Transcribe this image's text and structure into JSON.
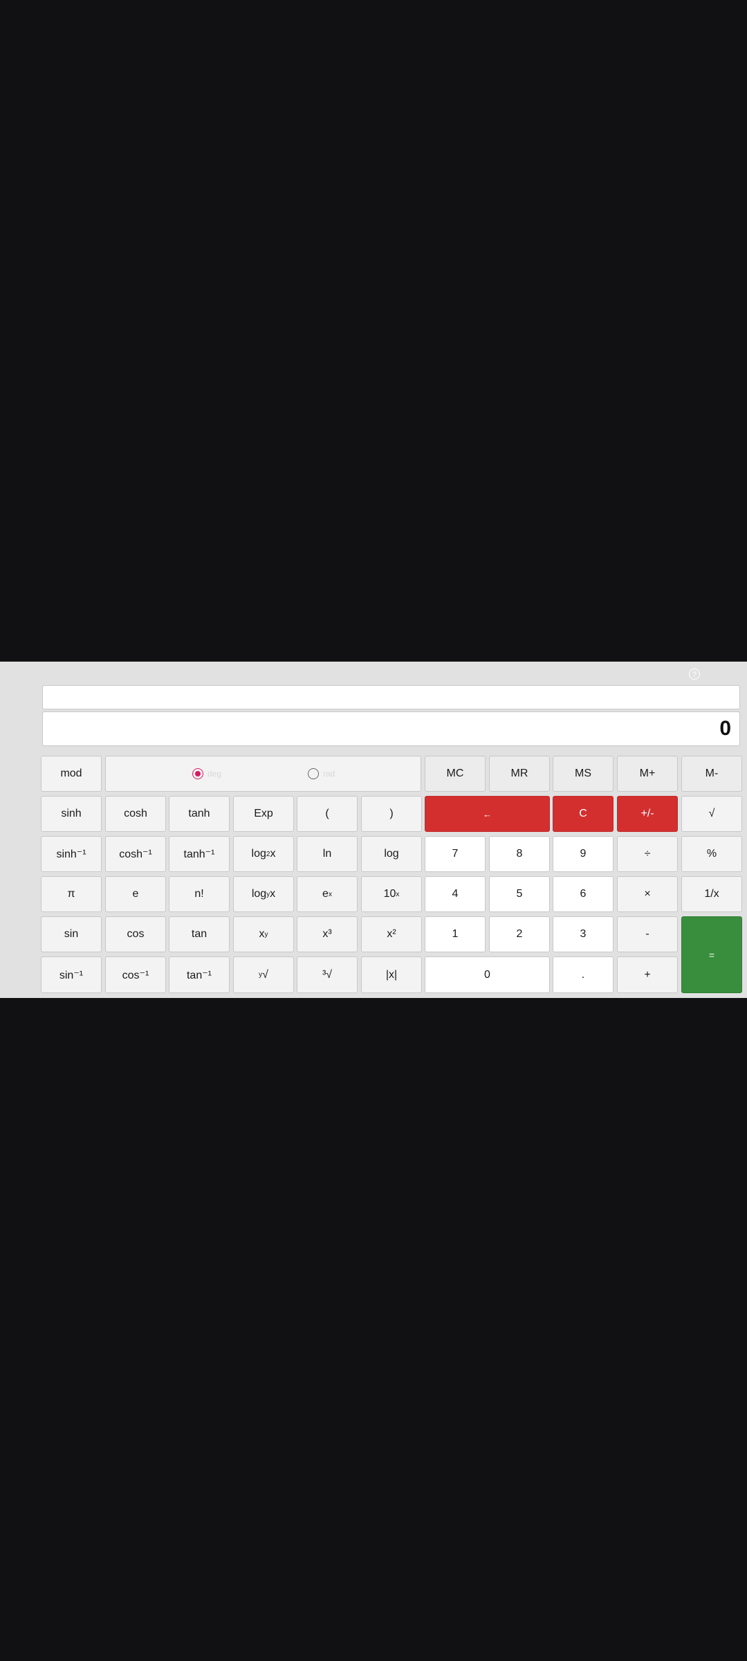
{
  "display": {
    "expression": "",
    "result": "0"
  },
  "angle_mode": {
    "options": [
      {
        "label": "deg",
        "selected": true
      },
      {
        "label": "rad",
        "selected": false
      }
    ]
  },
  "memory": {
    "mc": "MC",
    "mr": "MR",
    "ms": "MS",
    "mplus": "M+",
    "mminus": "M-"
  },
  "keys": {
    "mod": "mod",
    "sinh": "sinh",
    "cosh": "cosh",
    "tanh": "tanh",
    "exp": "Exp",
    "lparen": "(",
    "rparen": ")",
    "backspace": "←",
    "clear": "C",
    "negate": "+/-",
    "sqrt": "√",
    "asinh": "sinh⁻¹",
    "acosh": "cosh⁻¹",
    "atanh": "tanh⁻¹",
    "log2_base": "log",
    "log2_sub": "2",
    "log2_x": "x",
    "ln": "ln",
    "log": "log",
    "seven": "7",
    "eight": "8",
    "nine": "9",
    "divide": "÷",
    "percent": "%",
    "pi": "π",
    "e": "e",
    "factorial": "n!",
    "logy_base": "log",
    "logy_sub": "y",
    "logy_x": "x",
    "exp_base": "e",
    "exp_sup": "x",
    "ten_pow_base": "10",
    "ten_pow_sup": "x",
    "four": "4",
    "five": "5",
    "six": "6",
    "multiply": "×",
    "reciprocal": "1/x",
    "sin": "sin",
    "cos": "cos",
    "tan": "tan",
    "pow_base": "x",
    "pow_sup": "y",
    "cube": "x³",
    "square": "x²",
    "one": "1",
    "two": "2",
    "three": "3",
    "minus": "-",
    "equals": "=",
    "asin": "sin⁻¹",
    "acos": "cos⁻¹",
    "atan": "tan⁻¹",
    "yroot_sup": "y",
    "yroot_sym": "√",
    "cbrt": "³√",
    "abs": "|x|",
    "zero": "0",
    "decimal": ".",
    "plus": "+"
  },
  "help_icon": "?"
}
